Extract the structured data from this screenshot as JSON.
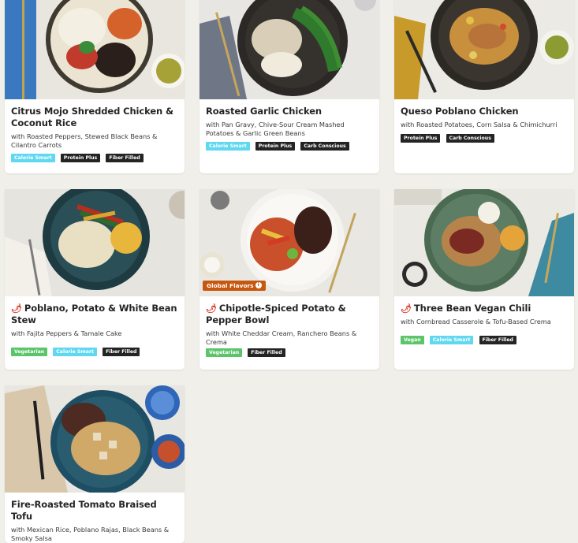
{
  "meals": [
    {
      "title": "Citrus Mojo Shredded Chicken & Coconut Rice",
      "subtitle": "with Roasted Peppers, Stewed Black Beans & Cilantro Carrots",
      "spicy": false,
      "tags": [
        "Calorie Smart",
        "Protein Plus",
        "Fiber Filled"
      ]
    },
    {
      "title": "Roasted Garlic Chicken",
      "subtitle": "with Pan Gravy, Chive-Sour Cream Mashed Potatoes & Garlic Green Beans",
      "spicy": false,
      "tags": [
        "Calorie Smart",
        "Protein Plus",
        "Carb Conscious"
      ]
    },
    {
      "title": "Queso Poblano Chicken",
      "subtitle": "with Roasted Potatoes, Corn Salsa & Chimichurri",
      "spicy": false,
      "tags": [
        "Protein Plus",
        "Carb Conscious"
      ]
    },
    {
      "title": "Poblano, Potato & White Bean Stew",
      "subtitle": "with Fajita Peppers & Tamale Cake",
      "spicy": true,
      "tags": [
        "Vegetarian",
        "Calorie Smart",
        "Fiber Filled"
      ]
    },
    {
      "title": "Chipotle-Spiced Potato & Pepper Bowl",
      "subtitle": "with White Cheddar Cream, Ranchero Beans & Crema",
      "spicy": true,
      "badge": "Global Flavors",
      "tags": [
        "Vegetarian",
        "Fiber Filled"
      ]
    },
    {
      "title": "Three Bean Vegan Chili",
      "subtitle": "with Cornbread Casserole & Tofu-Based Crema",
      "spicy": true,
      "tags": [
        "Vegan",
        "Calorie Smart",
        "Fiber Filled"
      ]
    },
    {
      "title": "Fire-Roasted Tomato Braised Tofu",
      "subtitle": "with Mexican Rice, Poblano Rajas, Black Beans & Smoky Salsa",
      "spicy": false,
      "tags": []
    }
  ],
  "icons": {
    "spicy": "chili-pepper-icon",
    "badge_info": "info-icon"
  },
  "colors": {
    "tag_calorie_smart": "#5fd8f0",
    "tag_dark": "#242424",
    "tag_vegetarian": "#5cc46a",
    "badge_global": "#c8570e",
    "spicy_icon": "#d8331f",
    "page_background": "#f1efe9"
  }
}
